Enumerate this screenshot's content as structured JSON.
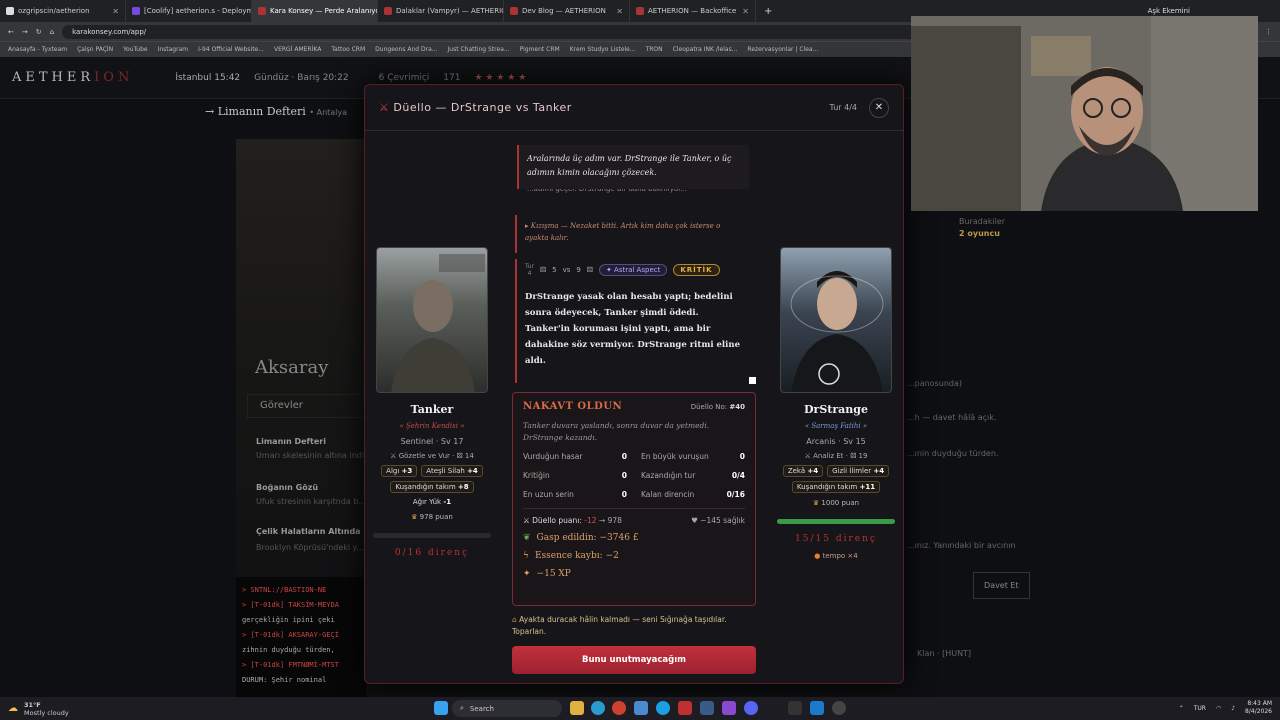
{
  "browser": {
    "tabs": [
      {
        "label": "ozgripscin/aetherion"
      },
      {
        "label": "[Coolify] aetherion.s - Deploym"
      },
      {
        "label": "Kara Konsey — Perde Aralanıyo",
        "active": true
      },
      {
        "label": "Dalaklar (Vampyr) — AETHERIO"
      },
      {
        "label": "Dev Blog — AETHERION"
      },
      {
        "label": "AETHERION — Backoffice"
      }
    ],
    "profile": "Aşk Ekemini",
    "url": "karakonsey.com/app/",
    "bookmarks": [
      "Anasayfa - Tyxteam",
      "Çalşn PAÇİN",
      "YouTube",
      "Instagram",
      "I-94 Official Website...",
      "VERGİ AMERİKA",
      "Tattoo CRM",
      "Dungeons And Dra...",
      "Just Chatting Strea...",
      "Pigment CRM",
      "Krem Studyo Listele...",
      "TRON",
      "Cleopatra INK /lelas...",
      "Rezervasyonlar | Clea..."
    ]
  },
  "site": {
    "logo_a": "AETHER",
    "logo_b": "ION",
    "header_items": [
      "İstanbul 15:42",
      "Gündüz · Barış 20:22",
      "6 Çevrimiçi",
      "171",
      "★ ★ ★ ★ ★"
    ],
    "crumb": "→ Limanın Defteri",
    "crumb_sub": "• Antalya",
    "location": "Aksaray",
    "tasks_title": "Görevler",
    "tasks": [
      {
        "title": "Limanın Defteri",
        "sub": "Umarı skelesinin altına indi..."
      },
      {
        "title": "Boğanın Gözü",
        "sub": "Ufuk stresinin karşıtnda b..."
      },
      {
        "title": "Çelik Halatların Altında",
        "sub": "Brooklyn Köprüsü'ndeki y..."
      }
    ],
    "terminal": [
      "> SNTNL://BASTION-NE",
      "> [T-01dk] TAKSİM-MEYDA",
      "gerçekliğin ipini çeki",
      "> [T-01dk] AKSARAY-GEÇİ",
      "zihnin duyduğu türden,",
      "> [T-01dk] FMTNØMİ-MTST",
      "DURUM: Şehir nominal"
    ],
    "right_panel": [
      "Buradakiler",
      "2 oyuncu",
      "...panosunda)",
      "...h — davet hâlâ açık.",
      "...ınin duyduğu türden.",
      "...ınız. Yanındaki bir avcının",
      "Davet Et",
      "Klan · [HUNT]"
    ]
  },
  "modal": {
    "title": "Düello — DrStrange vs Tanker",
    "turn": "Tur 4/4",
    "left": {
      "name": "Tanker",
      "title": "« Şehrin Kendisi »",
      "class": "Sentinel · Sv 17",
      "action": "Gözetle ve Vur · ",
      "dice": "14",
      "chips": [
        {
          "label": "Algı",
          "val": "+3"
        },
        {
          "label": "Ateşli Silah",
          "val": "+4"
        },
        {
          "label": "Kuşandığın takım",
          "val": "+8"
        },
        {
          "label": "Ağır Yük",
          "val": "-1"
        }
      ],
      "puan": "978 puan",
      "hp_fraction": 0,
      "direnc": "0/16 direnç"
    },
    "right": {
      "name": "DrStrange",
      "title": "« Sarmaş Fatihi »",
      "class": "Arcanis · Sv 15",
      "action": "Analiz Et · ",
      "dice": "19",
      "chips": [
        {
          "label": "Zekâ",
          "val": "+4"
        },
        {
          "label": "Gizli İlimler",
          "val": "+4"
        },
        {
          "label": "Kuşandığın takım",
          "val": "+11"
        }
      ],
      "puan": "1000 puan",
      "hp_fraction": 1,
      "direnc": "15/15 direnç",
      "tempo": "tempo ×4"
    },
    "log": {
      "quote": "Aralarında üç adım var. DrStrange ile Tanker, o üç adımın kimin olacağını çözecek.",
      "cut": "...adımı geçer. DrStrange bir daha bakmıyor...",
      "kizisma": "▸ Kızışma — Nezaket bitti. Artık kim daha çok isterse o ayakta kalır.",
      "turn_label": "Tur",
      "turn_no": "4",
      "d1": "5",
      "vs": "vs",
      "d2": "9",
      "astral": "✦ Astral Aspect",
      "krit": "KRİTİK",
      "text": "DrStrange yasak olan hesabı yaptı; bedelini sonra ödeyecek, Tanker şimdi ödedi. Tanker'in koruması işini yaptı, ama bir dahakine söz vermiyor. DrStrange ritmi eline aldı."
    },
    "result": {
      "title": "NAKAVT OLDUN",
      "no_label": "Düello No:",
      "no_val": "#40",
      "desc": "Tanker duvara yaslandı, sonra duvar da yetmedi. DrStrange kazandı.",
      "stats": [
        {
          "label": "Vurduğun hasar",
          "val": "0"
        },
        {
          "label": "En büyük vuruşun",
          "val": "0"
        },
        {
          "label": "Kritiğin",
          "val": "0"
        },
        {
          "label": "Kazandığın tur",
          "val": "0/4"
        },
        {
          "label": "En uzun serin",
          "val": "0"
        },
        {
          "label": "Kalan direncin",
          "val": "0/16"
        }
      ],
      "duel_label": "Düello puanı:",
      "duel_delta": "-12",
      "duel_arrow": "→ 978",
      "health": "♥ −145 sağlık",
      "losses": [
        {
          "icon": "❦",
          "text": "Gasp edildin: −3746 £",
          "color": "#6ab04a"
        },
        {
          "icon": "ϟ",
          "text": "Essence kaybı: −2",
          "color": "#e0a040"
        },
        {
          "icon": "✦",
          "text": "−15 XP",
          "color": "#d9a26a"
        }
      ]
    },
    "footnote": "Ayakta duracak hâlin kalmadı — seni Sığınağa taşıdılar. Toparlan.",
    "button": "Bunu unutmayacağım"
  },
  "taskbar": {
    "weather_temp": "31°F",
    "weather_desc": "Mostly cloudy",
    "search": "Search",
    "lang": "TUR",
    "time": "8:43 AM",
    "date": "8/4/2026"
  }
}
